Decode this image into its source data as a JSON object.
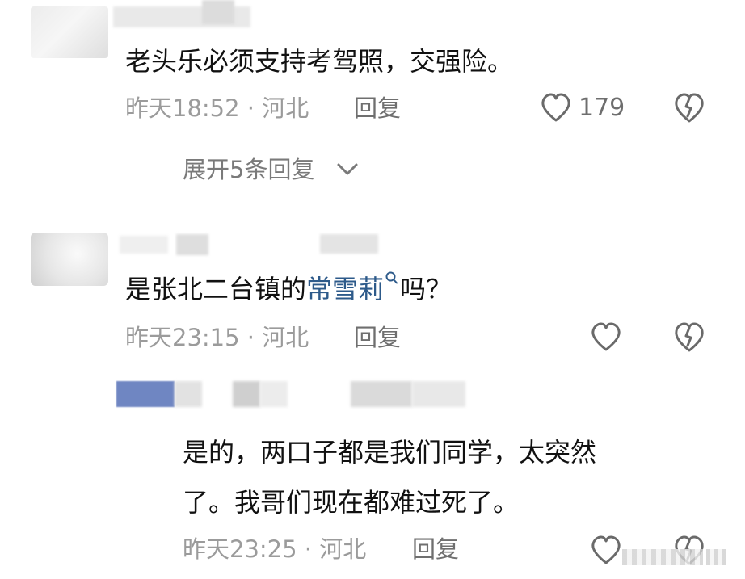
{
  "comments": [
    {
      "text": "老头乐必须支持考驾照，交强险。",
      "time": "昨天18:52 · 河北",
      "reply_label": "回复",
      "likes": "179",
      "expand_label": "展开5条回复"
    },
    {
      "text_before": "是张北二台镇的",
      "link_text": "常雪莉",
      "text_after": "吗？",
      "time": "昨天23:15 · 河北",
      "reply_label": "回复",
      "reply": {
        "text_line1": "是的，两口子都是我们同学，太突然",
        "text_line2": "了。我哥们现在都难过死了。",
        "time": "昨天23:25 · 河北",
        "reply_label": "回复"
      }
    }
  ],
  "icons": {
    "like": "heart-outline-icon",
    "dislike": "broken-heart-icon",
    "expand": "chevron-down-icon",
    "search": "search-icon"
  },
  "colors": {
    "text": "#111111",
    "meta": "#9b9b9b",
    "link": "#2d5a8a"
  }
}
